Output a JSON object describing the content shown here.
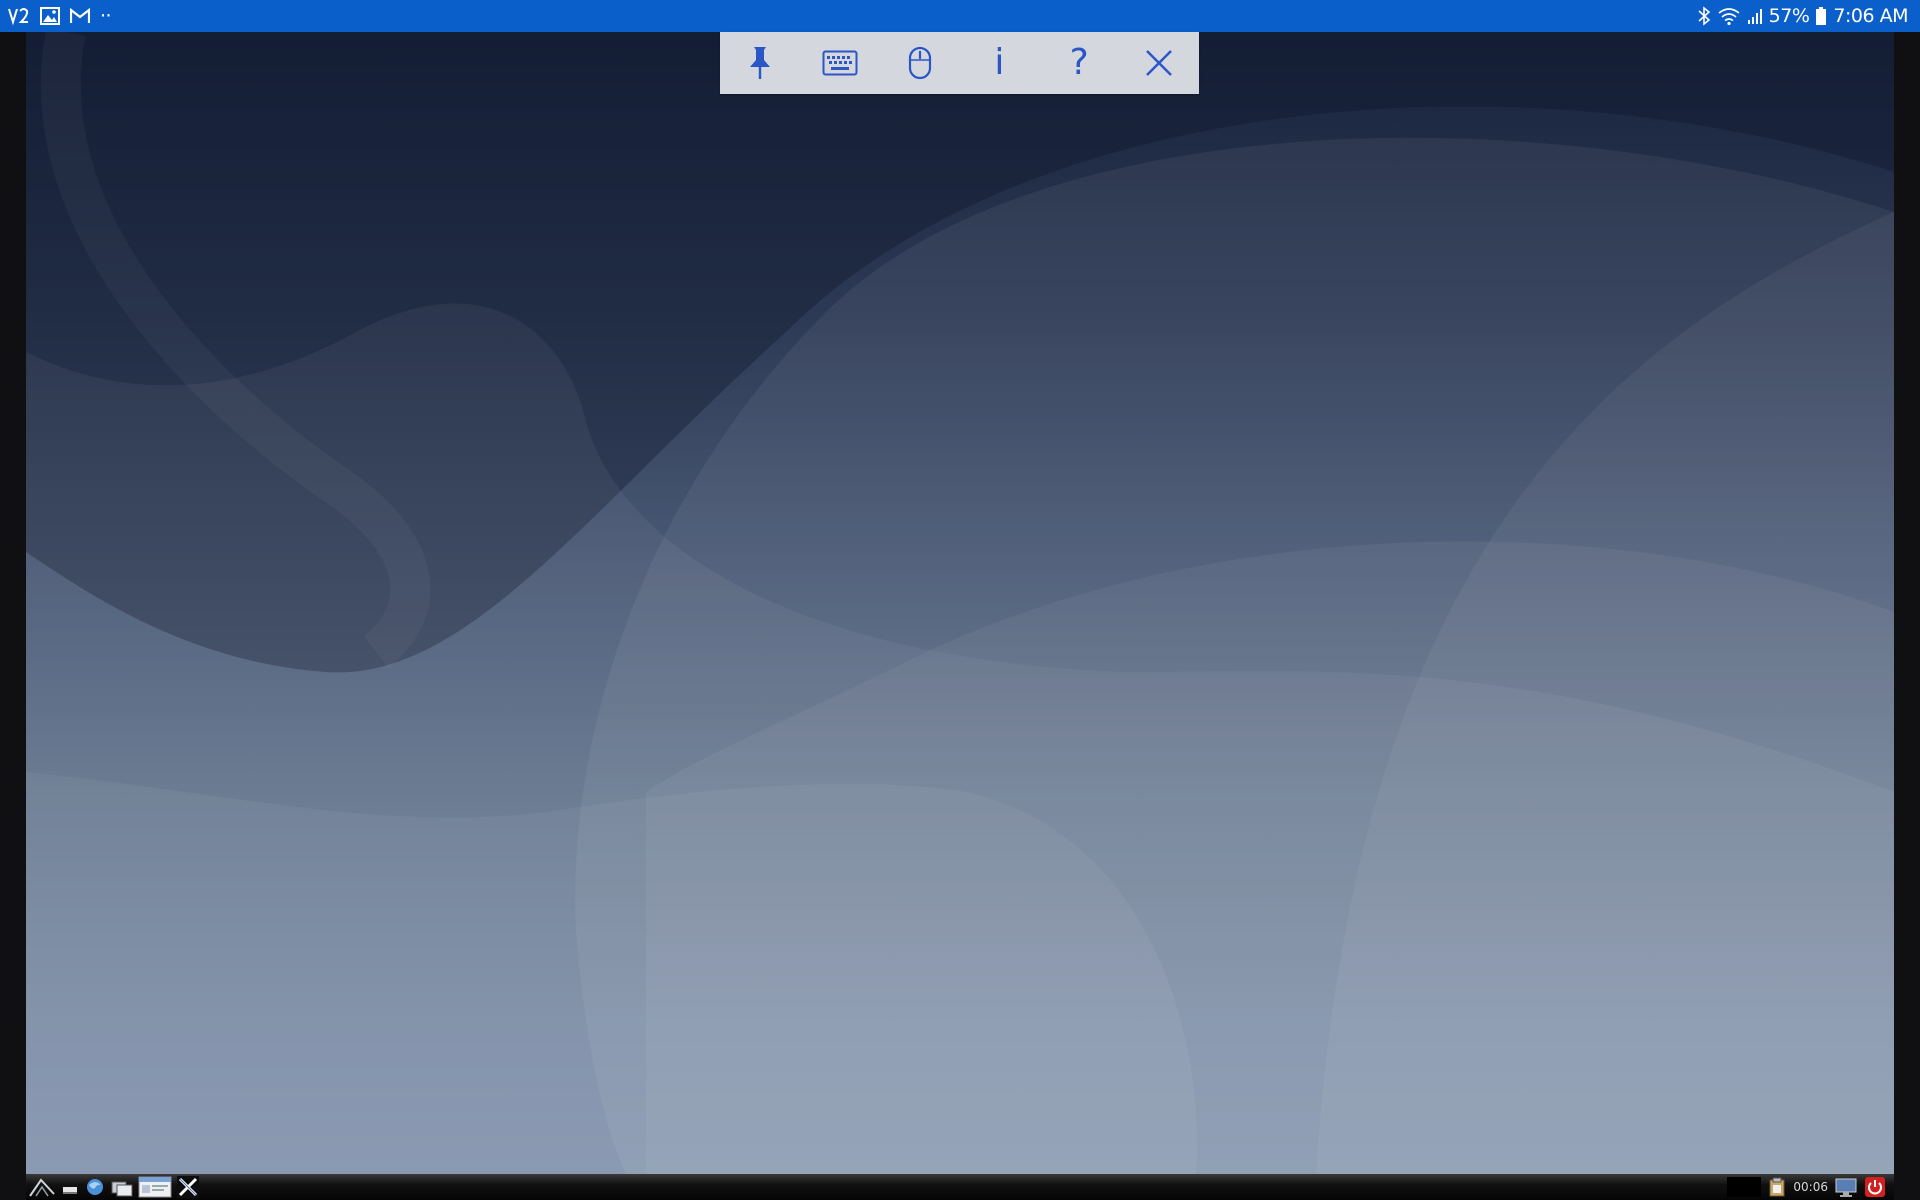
{
  "status_bar": {
    "left_icons": [
      "vnc-icon",
      "image-icon",
      "gmail-icon",
      "more-notifications-icon"
    ],
    "more_text": "··",
    "right_icons": [
      "bluetooth-icon",
      "wifi-icon",
      "signal-icon",
      "battery-icon"
    ],
    "battery_percent": "57%",
    "time": "7:06 AM",
    "colors": {
      "background": "#0b5fca",
      "text": "#ffffff"
    }
  },
  "toolbar": {
    "buttons": [
      {
        "name": "pin-button",
        "icon": "pin-icon"
      },
      {
        "name": "keyboard-button",
        "icon": "keyboard-icon"
      },
      {
        "name": "mouse-button",
        "icon": "mouse-icon"
      },
      {
        "name": "info-button",
        "icon": "info-icon",
        "glyph": "i"
      },
      {
        "name": "help-button",
        "icon": "help-icon",
        "glyph": "?"
      },
      {
        "name": "close-button",
        "icon": "close-icon"
      }
    ],
    "colors": {
      "background": "#d4d7de",
      "icon": "#2a56c6"
    }
  },
  "taskbar": {
    "left_icons": [
      "start-menu-icon",
      "minimize-all-icon",
      "browser-icon",
      "switch-windows-icon",
      "file-manager-icon",
      "x-terminal-icon"
    ],
    "right_icons": [
      "black-tray-box",
      "clipboard-icon",
      "monitor-icon",
      "power-icon"
    ],
    "clock": "00:06"
  },
  "desktop": {
    "wallpaper": "blue-gray-curves"
  }
}
